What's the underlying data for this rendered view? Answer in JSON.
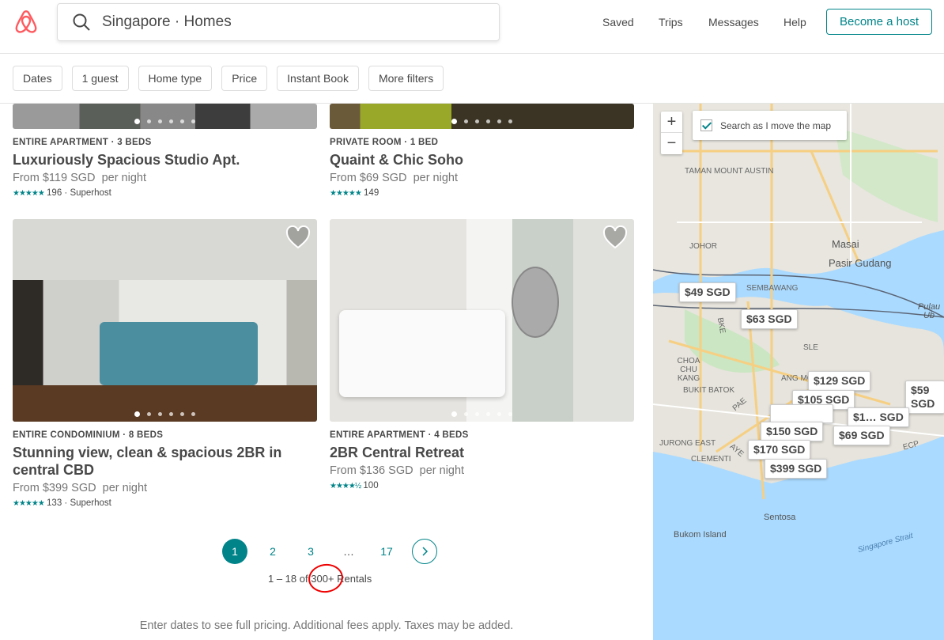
{
  "header": {
    "search_value": "Singapore · Homes",
    "nav": [
      "Saved",
      "Trips",
      "Messages",
      "Help"
    ],
    "host_label": "Become a host"
  },
  "filters": [
    "Dates",
    "1 guest",
    "Home type",
    "Price",
    "Instant Book",
    "More filters"
  ],
  "listings": [
    {
      "kind": "ENTIRE APARTMENT · 3 BEDS",
      "title": "Luxuriously Spacious Studio Apt.",
      "price": "From $119 SGD",
      "per": "per night",
      "stars": "★★★★★",
      "reviews": "196",
      "badge": "· Superhost"
    },
    {
      "kind": "PRIVATE ROOM · 1 BED",
      "title": "Quaint & Chic Soho",
      "price": "From $69 SGD",
      "per": "per night",
      "stars": "★★★★★",
      "reviews": "149",
      "badge": ""
    },
    {
      "kind": "ENTIRE CONDOMINIUM · 8 BEDS",
      "title": "Stunning view, clean & spacious 2BR in central CBD",
      "price": "From $399 SGD",
      "per": "per night",
      "stars": "★★★★★",
      "reviews": "133",
      "badge": "· Superhost"
    },
    {
      "kind": "ENTIRE APARTMENT · 4 BEDS",
      "title": "2BR Central Retreat",
      "price": "From $136 SGD",
      "per": "per night",
      "stars": "★★★★½",
      "reviews": "100",
      "badge": ""
    }
  ],
  "pagination": {
    "pages": [
      "1",
      "2",
      "3",
      "…",
      "17"
    ],
    "current": "1",
    "count_prefix": "1 – 18 of",
    "count_total": "300+",
    "count_suffix": "Rentals"
  },
  "footer_note": "Enter dates to see full pricing. Additional fees apply. Taxes may be added.",
  "map": {
    "zoom_in": "+",
    "zoom_out": "−",
    "search_toggle": "Search as I move the map",
    "search_toggle_checked": true,
    "pins": [
      "$49 SGD",
      "$63 SGD",
      "$129 SGD",
      "$105 SGD",
      "$59 SGD",
      "$1… SGD",
      "$69 SGD",
      "$150 SGD",
      "$170 SGD",
      "$399 SGD"
    ],
    "labels": [
      "TAMAN MOUNT AUSTIN",
      "JOHOR",
      "Masai",
      "Pasir Gudang",
      "SEMBAWANG",
      "CHOA CHU KANG",
      "BUKIT BATOK",
      "JURONG EAST",
      "CLEMENTI",
      "Sentosa",
      "Bukom Island",
      "Singapore Strait",
      "Pulau Ub",
      "ANG MO",
      "SLE",
      "BKE",
      "PAE",
      "AYE",
      "ECP"
    ]
  },
  "colors": {
    "accent": "#008489",
    "brand": "#FF5A5F",
    "annotation": "#e00000"
  }
}
